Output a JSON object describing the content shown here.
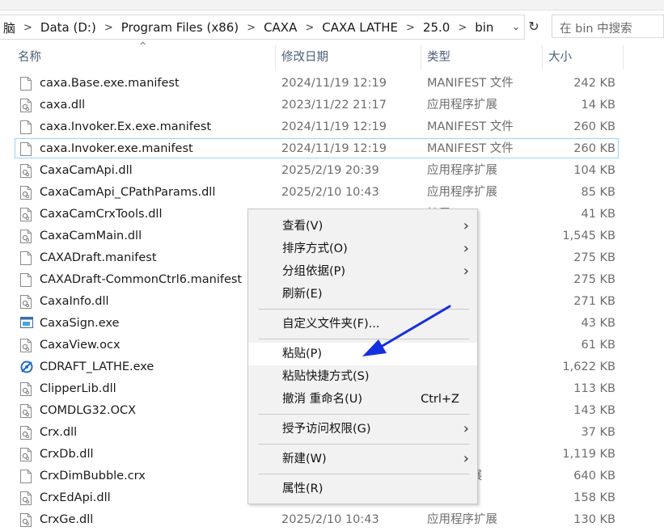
{
  "breadcrumb": [
    "脑",
    "Data (D:)",
    "Program Files (x86)",
    "CAXA",
    "CAXA LATHE",
    "25.0",
    "bin"
  ],
  "search": {
    "placeholder": "在 bin 中搜索"
  },
  "columns": {
    "name": "名称",
    "date": "修改日期",
    "type": "类型",
    "size": "大小"
  },
  "files": [
    {
      "name": "caxa.Base.exe.manifest",
      "date": "2024/11/19 12:19",
      "type": "MANIFEST 文件",
      "size": "242 KB",
      "icon": "file-icon"
    },
    {
      "name": "caxa.dll",
      "date": "2023/11/22 21:17",
      "type": "应用程序扩展",
      "size": "14 KB",
      "icon": "dll-icon"
    },
    {
      "name": "caxa.Invoker.Ex.exe.manifest",
      "date": "2024/11/19 12:19",
      "type": "MANIFEST 文件",
      "size": "260 KB",
      "icon": "file-icon"
    },
    {
      "name": "caxa.Invoker.exe.manifest",
      "date": "2024/11/19 12:19",
      "type": "MANIFEST 文件",
      "size": "260 KB",
      "icon": "file-icon"
    },
    {
      "name": "CaxaCamApi.dll",
      "date": "2025/2/19 20:39",
      "type": "应用程序扩展",
      "size": "104 KB",
      "icon": "dll-icon"
    },
    {
      "name": "CaxaCamApi_CPathParams.dll",
      "date": "2025/2/10 10:43",
      "type": "应用程序扩展",
      "size": "85 KB",
      "icon": "dll-icon"
    },
    {
      "name": "CaxaCamCrxTools.dll",
      "date": "",
      "type": "扩展",
      "size": "41 KB",
      "icon": "dll-icon"
    },
    {
      "name": "CaxaCamMain.dll",
      "date": "",
      "type": "扩展",
      "size": "1,545 KB",
      "icon": "dll-icon"
    },
    {
      "name": "CAXADraft.manifest",
      "date": "",
      "type": "ST 文件",
      "size": "275 KB",
      "icon": "file-icon"
    },
    {
      "name": "CAXADraft-CommonCtrl6.manifest",
      "date": "",
      "type": "ST 文件",
      "size": "275 KB",
      "icon": "file-icon"
    },
    {
      "name": "CaxaInfo.dll",
      "date": "",
      "type": "扩展",
      "size": "271 KB",
      "icon": "dll-icon"
    },
    {
      "name": "CaxaSign.exe",
      "date": "",
      "type": "",
      "size": "43 KB",
      "icon": "exe-icon"
    },
    {
      "name": "CaxaView.ocx",
      "date": "",
      "type": "控件",
      "size": "61 KB",
      "icon": "dll-icon"
    },
    {
      "name": "CDRAFT_LATHE.exe",
      "date": "",
      "type": "",
      "size": "1,622 KB",
      "icon": "lathe-app-icon"
    },
    {
      "name": "ClipperLib.dll",
      "date": "",
      "type": "扩展",
      "size": "113 KB",
      "icon": "dll-icon"
    },
    {
      "name": "COMDLG32.OCX",
      "date": "",
      "type": "控件",
      "size": "143 KB",
      "icon": "dll-icon"
    },
    {
      "name": "Crx.dll",
      "date": "",
      "type": "扩展",
      "size": "37 KB",
      "icon": "dll-icon"
    },
    {
      "name": "CrxDb.dll",
      "date": "",
      "type": "扩展",
      "size": "1,119 KB",
      "icon": "dll-icon"
    },
    {
      "name": "CrxDimBubble.crx",
      "date": "",
      "type": ") 核心扩展",
      "size": "640 KB",
      "icon": "file-icon"
    },
    {
      "name": "CrxEdApi.dll",
      "date": "",
      "type": "扩展",
      "size": "158 KB",
      "icon": "dll-icon"
    },
    {
      "name": "CrxGe.dll",
      "date": "2025/2/10 10:43",
      "type": "应用程序扩展",
      "size": "130 KB",
      "icon": "dll-icon"
    }
  ],
  "context_menu": {
    "view": "查看(V)",
    "sort": "排序方式(O)",
    "group": "分组依据(P)",
    "refresh": "刷新(E)",
    "customize": "自定义文件夹(F)...",
    "paste": "粘贴(P)",
    "paste_shortcut": "粘贴快捷方式(S)",
    "undo": "撤消 重命名(U)",
    "undo_shortcut": "Ctrl+Z",
    "grant_access": "授予访问权限(G)",
    "new": "新建(W)",
    "properties": "属性(R)"
  },
  "colors": {
    "arrow": "#1530e0",
    "focus": "#99d1ff",
    "menu_bg": "#f2f2f2"
  }
}
